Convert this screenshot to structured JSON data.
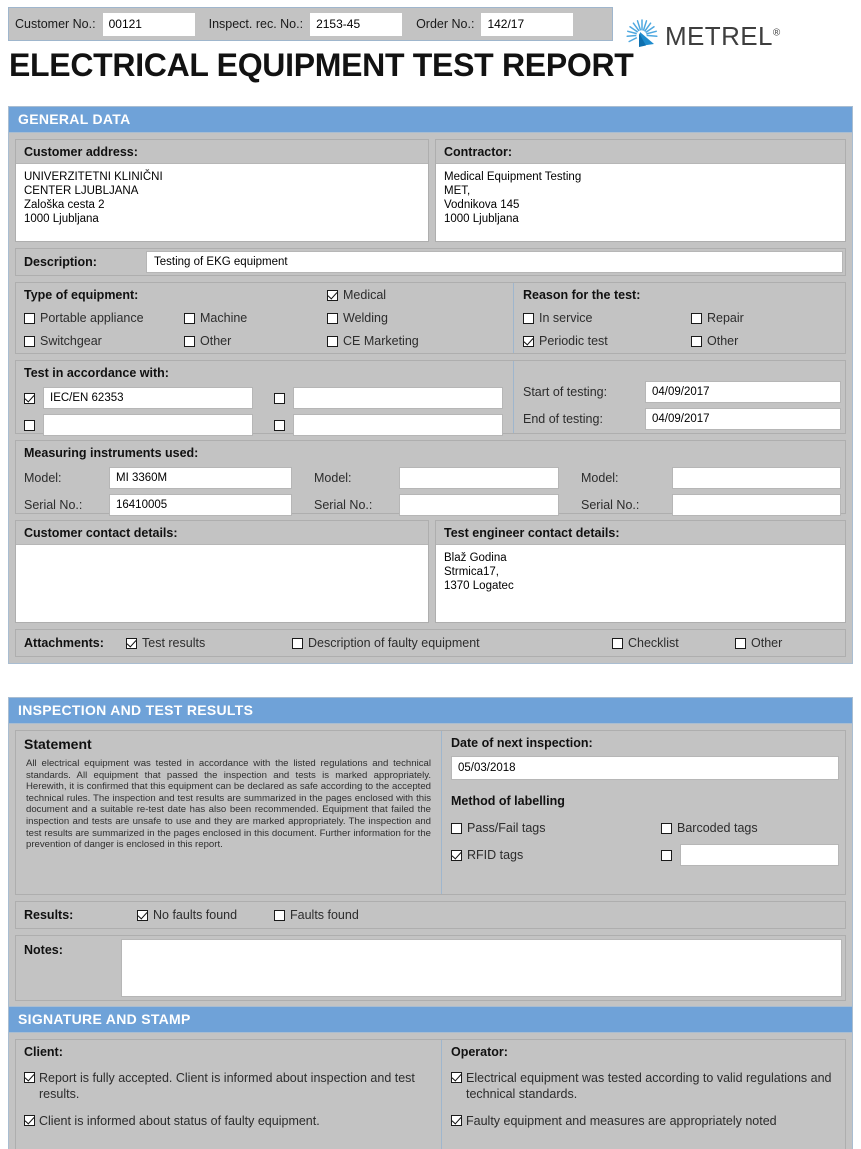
{
  "header": {
    "fields": [
      {
        "label": "Customer No.:",
        "value": "00121"
      },
      {
        "label": "Inspect. rec. No.:",
        "value": "2153-45"
      },
      {
        "label": "Order No.:",
        "value": "142/17"
      }
    ],
    "logo_text": "METREL",
    "logo_registered": "®",
    "title": "ELECTRICAL EQUIPMENT TEST REPORT"
  },
  "general_data": {
    "heading": "GENERAL DATA",
    "customer_address": {
      "label": "Customer address:",
      "lines": [
        "UNIVERZITETNI KLINIČNI",
        "CENTER LJUBLJANA",
        "Zaloška cesta 2",
        "1000 Ljubljana"
      ]
    },
    "contractor": {
      "label": "Contractor:",
      "lines": [
        "Medical Equipment Testing",
        "MET,",
        "Vodnikova 145",
        "1000 Ljubljana"
      ]
    },
    "description": {
      "label": "Description:",
      "value": "Testing of EKG equipment"
    },
    "type_of_equipment": {
      "label": "Type of equipment:",
      "items": [
        {
          "label": "Medical",
          "checked": true
        },
        {
          "label": "Portable appliance",
          "checked": false
        },
        {
          "label": "Machine",
          "checked": false
        },
        {
          "label": "Welding",
          "checked": false
        },
        {
          "label": "Switchgear",
          "checked": false
        },
        {
          "label": "Other",
          "checked": false
        },
        {
          "label": "CE Marketing",
          "checked": false
        }
      ]
    },
    "reason_for_test": {
      "label": "Reason for the test:",
      "items": [
        {
          "label": "In service",
          "checked": false
        },
        {
          "label": "Repair",
          "checked": false
        },
        {
          "label": "Periodic test",
          "checked": true
        },
        {
          "label": "Other",
          "checked": false
        }
      ]
    },
    "test_in_accordance": {
      "label": "Test in accordance with:",
      "entries": [
        {
          "checked": true,
          "value": "IEC/EN 62353"
        },
        {
          "checked": false,
          "value": ""
        },
        {
          "checked": false,
          "value": ""
        },
        {
          "checked": false,
          "value": ""
        }
      ]
    },
    "testing_dates": {
      "start_label": "Start of testing:",
      "start_value": "04/09/2017",
      "end_label": "End of testing:",
      "end_value": "04/09/2017"
    },
    "instruments": {
      "label": "Measuring instruments used:",
      "model_label": "Model:",
      "serial_label": "Serial No.:",
      "columns": [
        {
          "model": "MI 3360M",
          "serial": "16410005"
        },
        {
          "model": "",
          "serial": ""
        },
        {
          "model": "",
          "serial": ""
        }
      ]
    },
    "customer_contact": {
      "label": "Customer contact details:",
      "lines": []
    },
    "engineer_contact": {
      "label": "Test engineer contact details:",
      "lines": [
        "Blaž Godina",
        "Strmica17,",
        "1370 Logatec"
      ]
    },
    "attachments": {
      "label": "Attachments:",
      "items": [
        {
          "label": "Test results",
          "checked": true
        },
        {
          "label": "Description of faulty equipment",
          "checked": false
        },
        {
          "label": "Checklist",
          "checked": false
        },
        {
          "label": "Other",
          "checked": false
        }
      ]
    }
  },
  "inspection": {
    "heading": "INSPECTION AND TEST RESULTS",
    "statement_title": "Statement",
    "statement_text": "All electrical equipment was tested in accordance with the listed regulations and technical standards. All equipment that passed the inspection and tests is marked appropriately. Herewith, it is confirmed that this equipment can be declared as safe according to the accepted technical rules. The inspection and test results are summarized in the pages enclosed with this document and a suitable re-test date has also been recommended. Equipment that failed the inspection and tests are unsafe to use and they are marked appropriately. The inspection and test results are summarized in the pages enclosed in this document. Further information for the prevention of danger is enclosed in this report.",
    "next_inspection": {
      "label": "Date of next inspection:",
      "value": "05/03/2018"
    },
    "method_of_labelling": {
      "label": "Method of labelling",
      "items": [
        {
          "label": "Pass/Fail tags",
          "checked": false
        },
        {
          "label": "Barcoded tags",
          "checked": false
        },
        {
          "label": "RFID tags",
          "checked": true
        },
        {
          "label": "",
          "checked": false,
          "is_input": true,
          "value": ""
        }
      ]
    },
    "results": {
      "label": "Results:",
      "items": [
        {
          "label": "No faults found",
          "checked": true
        },
        {
          "label": "Faults found",
          "checked": false
        }
      ]
    },
    "notes": {
      "label": "Notes:",
      "value": ""
    }
  },
  "signature": {
    "heading": "SIGNATURE AND STAMP",
    "client": {
      "label": "Client:",
      "items": [
        {
          "label": "Report is fully accepted. Client is informed about inspection and  test results.",
          "checked": true
        },
        {
          "label": "Client is informed about status of faulty equipment.",
          "checked": true
        }
      ]
    },
    "operator": {
      "label": "Operator:",
      "items": [
        {
          "label": "Electrical equipment was tested according to valid regulations and technical standards.",
          "checked": true
        },
        {
          "label": "Faulty equipment and measures are appropriately noted",
          "checked": true
        }
      ]
    }
  },
  "colors": {
    "section_header": "#6fa2d8",
    "panel_gray": "#c3c3c3",
    "border_blue": "#a9bdd1",
    "logo_blue": "#1e8bcd"
  }
}
